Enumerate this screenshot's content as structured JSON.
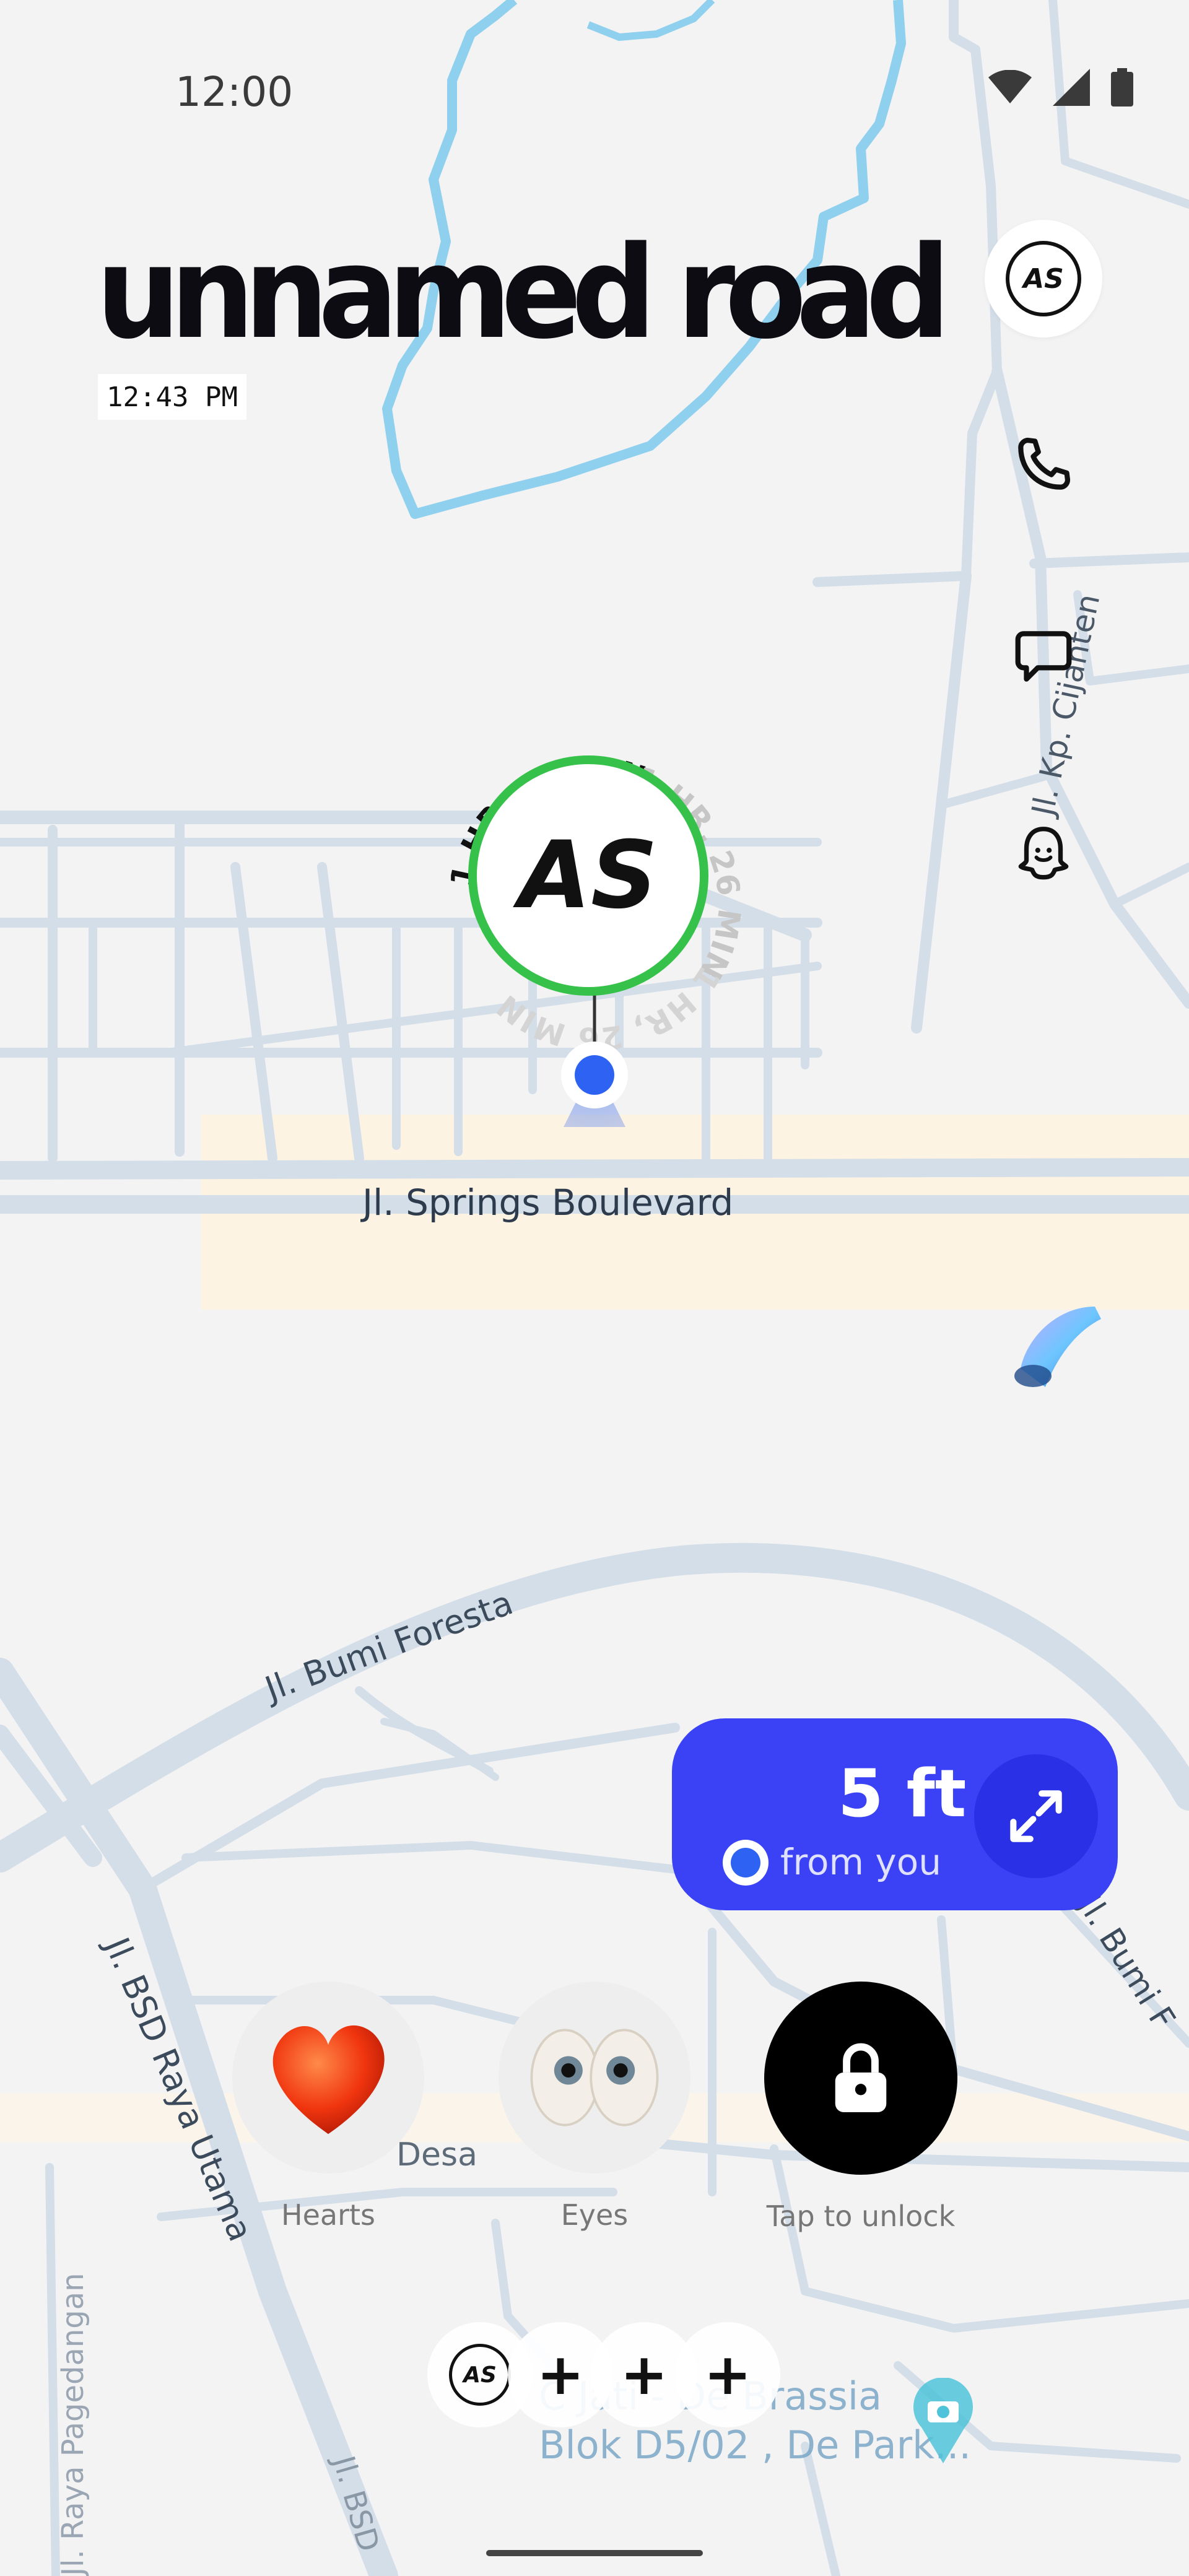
{
  "status_bar": {
    "time": "12:00"
  },
  "header": {
    "road_name": "unnamed road",
    "time": "12:43 PM"
  },
  "side_actions": {
    "avatar_initials": "AS",
    "items": [
      "avatar",
      "call",
      "chat",
      "snap-ghost"
    ]
  },
  "friend": {
    "initials": "AS",
    "eta_label": "1 HR, 26 MIN"
  },
  "map_labels": {
    "springs": "Jl. Springs Boulevard",
    "bumi_foresta": "Jl. Bumi Foresta",
    "kp_cijanten": "Jl. Kp. Cijanten",
    "bsd_raya_utama": "Jl. BSD Raya Utama",
    "bumi_right": "Jl. Bumi F",
    "desa": "Desa",
    "raya_pagedangan": "Jl. Raya Pagedangan",
    "bsd_bottom": "Jl. BSD",
    "place_line1": "C Jati - De Brassia",
    "place_line2": "Blok D5/02 , De Park..."
  },
  "distance_card": {
    "value": "5 ft",
    "sublabel": "from you"
  },
  "reactions": [
    {
      "label": "Hearts",
      "icon": "heart-icon"
    },
    {
      "label": "Eyes",
      "icon": "eyes-icon"
    },
    {
      "label": "Tap to unlock",
      "icon": "lock-icon"
    }
  ],
  "bottom_chips": {
    "avatar_initials": "AS",
    "plus": "+"
  },
  "colors": {
    "accent_blue": "#3b42f5",
    "ring_green": "#36c24a",
    "location_dot": "#2e62f2",
    "water": "#8fd0ef",
    "road": "#cfdbe6"
  }
}
